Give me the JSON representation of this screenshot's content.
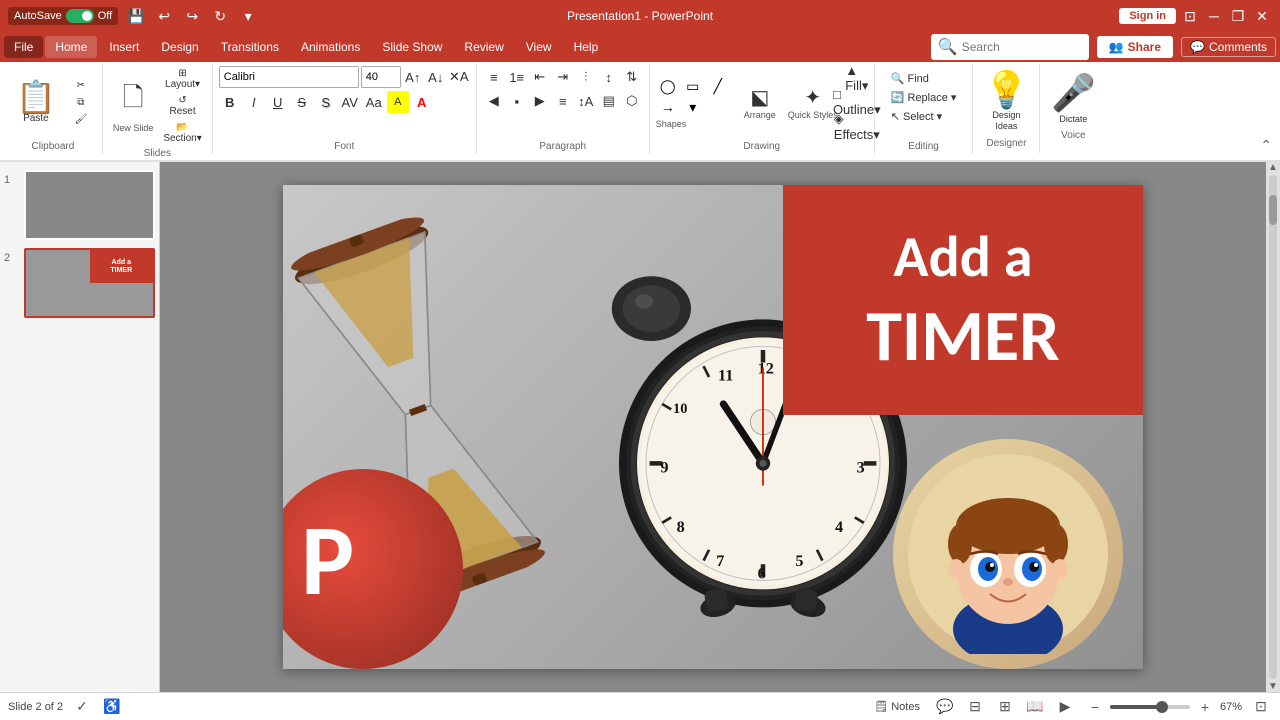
{
  "titlebar": {
    "autosave_label": "AutoSave",
    "autosave_state": "Off",
    "title": "Presentation1 - PowerPoint",
    "signin_label": "Sign in",
    "minimize_icon": "─",
    "restore_icon": "❐",
    "close_icon": "✕"
  },
  "menubar": {
    "items": [
      {
        "id": "file",
        "label": "File"
      },
      {
        "id": "home",
        "label": "Home"
      },
      {
        "id": "insert",
        "label": "Insert"
      },
      {
        "id": "design",
        "label": "Design"
      },
      {
        "id": "transitions",
        "label": "Transitions"
      },
      {
        "id": "animations",
        "label": "Animations"
      },
      {
        "id": "slideshow",
        "label": "Slide Show"
      },
      {
        "id": "review",
        "label": "Review"
      },
      {
        "id": "view",
        "label": "View"
      },
      {
        "id": "help",
        "label": "Help"
      }
    ],
    "search_placeholder": "Search",
    "share_label": "Share",
    "comments_label": "Comments"
  },
  "toolbar": {
    "groups": {
      "clipboard": {
        "label": "Clipboard",
        "paste_label": "Paste",
        "cut_label": "Cut",
        "copy_label": "Copy",
        "format_painter_label": "Format Painter"
      },
      "slides": {
        "label": "Slides",
        "new_slide_label": "New Slide",
        "layout_label": "Layout",
        "reset_label": "Reset",
        "section_label": "Section"
      },
      "font": {
        "label": "Font",
        "font_name": "Calibri",
        "font_size": "40",
        "bold": "B",
        "italic": "I",
        "underline": "U",
        "strikethrough": "S",
        "shadow": "S",
        "font_color": "A",
        "char_spacing": "↔",
        "change_case": "Aa",
        "highlight": "🖊"
      },
      "paragraph": {
        "label": "Paragraph",
        "bullets": "≡",
        "numbering": "1.",
        "indent_decrease": "←",
        "indent_increase": "→",
        "line_spacing": "↕",
        "columns": "⫶",
        "align_left": "◀",
        "align_center": "▪",
        "align_right": "▶",
        "align_justify": "≡",
        "text_direction": "↕",
        "align_text": "▤",
        "smartart": "⬡"
      },
      "drawing": {
        "label": "Drawing",
        "shapes_label": "Shapes",
        "arrange_label": "Arrange",
        "quick_styles_label": "Quick Styles",
        "shape_fill": "▲",
        "shape_outline": "□",
        "shape_effects": "◈"
      },
      "editing": {
        "label": "Editing",
        "find_label": "Find",
        "replace_label": "Replace",
        "select_label": "Select"
      },
      "designer": {
        "label": "Designer",
        "design_ideas_label": "Design Ideas"
      },
      "voice": {
        "label": "Voice",
        "dictate_label": "Dictate"
      }
    }
  },
  "slides": {
    "current": 2,
    "total": 2,
    "items": [
      {
        "num": 1,
        "active": false
      },
      {
        "num": 2,
        "active": true
      }
    ]
  },
  "slide_content": {
    "red_box_line1": "Add a",
    "red_box_line2": "TIMER",
    "ppt_letter": "P"
  },
  "statusbar": {
    "slide_info": "Slide 2 of 2",
    "notes_label": "Notes",
    "zoom_level": "67%",
    "fit_slide_icon": "⊡"
  }
}
